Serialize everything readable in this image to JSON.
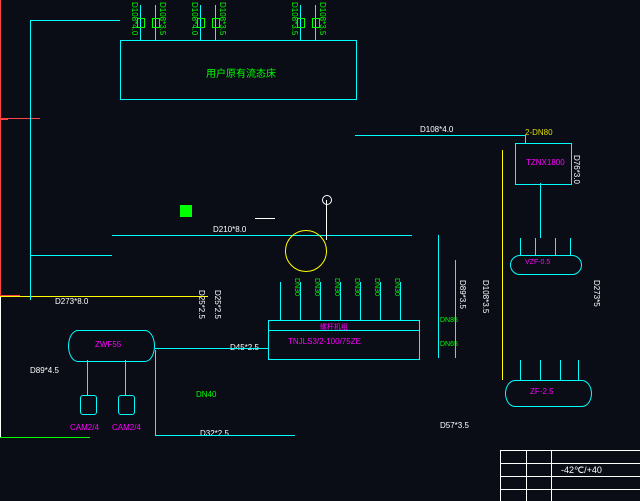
{
  "topBlock": {
    "label": "用户原有流态床"
  },
  "topValves": [
    "D108*4.0",
    "D108*3.5",
    "D108*4.0",
    "D108*3.5",
    "D108*3.5",
    "D108*3.5"
  ],
  "pipes": {
    "headerLeft": "D273*8.0",
    "middle": "D210*8.0",
    "topRight": "D108*4.0",
    "bottomLeft": "D89*4.5",
    "bottomMiddle": "D32*2.5",
    "d25a": "D25*2.5",
    "d25b": "D25*2.5",
    "d45": "D45*2.5",
    "d57": "D57*3.5",
    "d89": "D89*3.5",
    "d273": "D273*5",
    "d108r": "D108*3.5",
    "d76": "D76*3.0",
    "topValve2": "2-DN80"
  },
  "equipment": {
    "zwf": "ZWF55",
    "cam1": "CAM2/4",
    "cam2": "CAM2/4",
    "dn40": "DN40",
    "tnj": "TNJLS3/2-100/75ZE",
    "tnjTop": "螺杆机组",
    "tznx": "TZNX1800",
    "vzf": "VZF-0.5",
    "zf": "ZF-2.5",
    "dn85": "DN85",
    "dn65": "DN65"
  },
  "titleBlock": {
    "temp": "-42℃/+40"
  }
}
